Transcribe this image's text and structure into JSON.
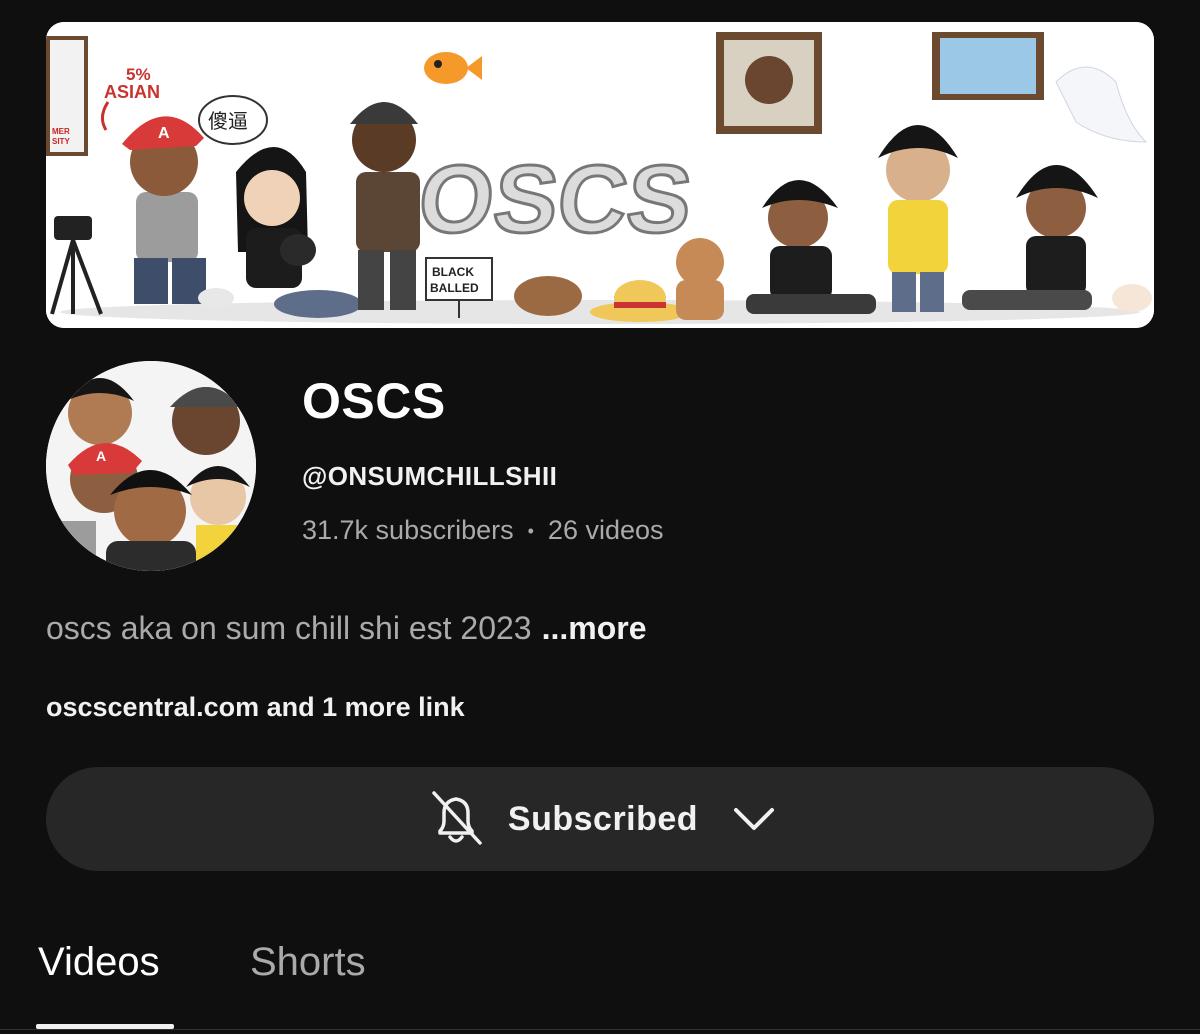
{
  "banner": {
    "tshirt_text": "5%",
    "tshirt_text2": "ASIAN",
    "sign_line1": "BLACK",
    "sign_line2": "BALLED",
    "speech": "傻逼",
    "logo": "OSCS",
    "shirt_small": "MER",
    "shirt_small2": "SITY"
  },
  "channel": {
    "name": "OSCS",
    "handle": "@ONSUMCHILLSHII",
    "subscribers": "31.7k subscribers",
    "separator": "•",
    "videos": "26 videos",
    "description": "oscs aka on sum chill shi est 2023",
    "more_label": "...more",
    "links_text": "oscscentral.com and 1 more link"
  },
  "subscribe": {
    "label": "Subscribed",
    "bell_icon": "bell-off-icon",
    "chevron_icon": "chevron-down-icon"
  },
  "tabs": [
    {
      "label": "Videos",
      "selected": true
    },
    {
      "label": "Shorts",
      "selected": false
    }
  ]
}
